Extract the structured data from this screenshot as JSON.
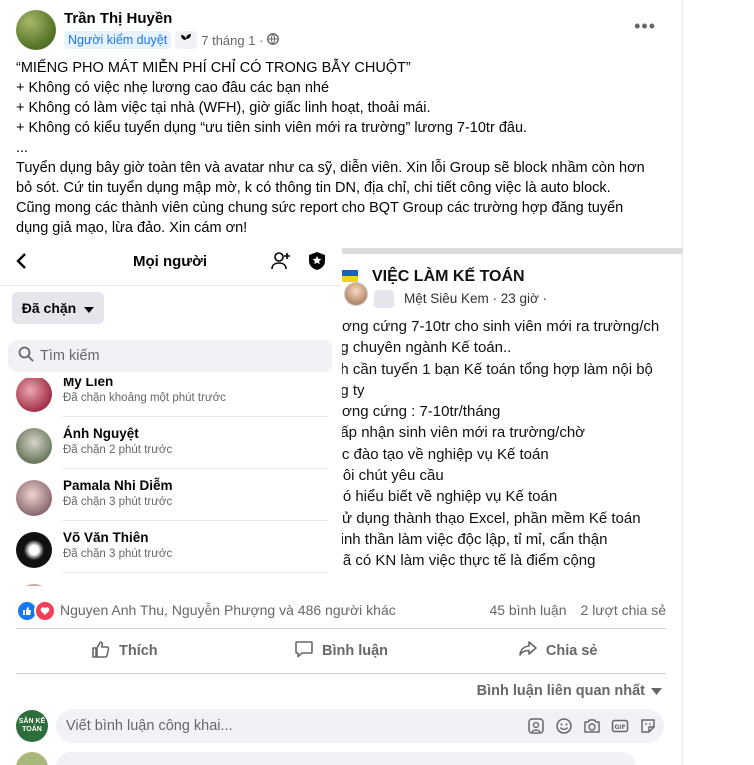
{
  "post": {
    "author": "Trần Thị Huyền",
    "badge": "Người kiểm duyệt",
    "time": "7 tháng 1 ·",
    "lines": [
      "“MIẾNG PHO MÁT MIỄN PHÍ CHỈ CÓ TRONG BẪY CHUỘT”",
      "+ Không có việc nhẹ lương cao đâu các bạn nhé",
      "+ Không có làm việc tại nhà (WFH), giờ giấc linh hoạt, thoải mái.",
      "+ Không có kiểu tuyển dụng “ưu tiên sinh viên mới ra trường” lương 7-10tr đâu.",
      "...",
      "Tuyển dụng bây giờ toàn tên và avatar như ca sỹ, diễn viên. Xin lỗi Group sẽ block nhầm còn hơn",
      "bỏ sót. Cứ tin tuyển dụng mập mờ, k có thông tin DN, địa chỉ, chi tiết công việc là auto block.",
      "Cũng mong các thành viên cùng chung sức report cho BQT Group các trường hợp đăng tuyển",
      "dụng giả mạo, lừa đảo. Xin cám ơn!"
    ]
  },
  "left_screenshot": {
    "title": "Mọi người",
    "chip": "Đã chặn",
    "search_placeholder": "Tìm kiếm",
    "people": [
      {
        "name": "My Lien",
        "sub": "Đã chặn khoảng một phút trước"
      },
      {
        "name": "Ánh Nguyệt",
        "sub": "Đã chặn 2 phút trước"
      },
      {
        "name": "Pamala Nhi Diễm",
        "sub": "Đã chặn 3 phút trước"
      },
      {
        "name": "Võ Văn Thiên",
        "sub": "Đã chặn 3 phút trước"
      }
    ]
  },
  "right_screenshot": {
    "title": "VIỆC LÀM KẾ TOÁN",
    "author": "Mệt Siêu Kem · 23 giờ ·",
    "lines": [
      "ương cứng 7-10tr cho sinh viên mới ra trường/ch",
      "ng chuyên ngành Kế toán..",
      "nh cần tuyển 1 bạn Kế toán tổng hợp làm nội bộ",
      "ng ty",
      "ương cứng : 7-10tr/tháng",
      "hấp nhận sinh viên mới ra trường/chờ",
      "ợc đào tạo về nghiệp vụ Kế toán",
      " Đôi chút yêu cầu",
      "Có hiểu biết về nghiệp vụ Kế toán",
      "Sử dụng thành thạo Excel, phần mềm Kế toán",
      "Tinh thần làm việc độc lập, tỉ mỉ, cẩn thận",
      "Đã có KN làm việc thực tế là điểm cộng"
    ]
  },
  "stats": {
    "likers": "Nguyen Anh Thu, Nguyễn Phượng và 486 người khác",
    "comments": "45 bình luận",
    "shares": "2 lượt chia sẻ"
  },
  "actions": {
    "like": "Thích",
    "comment": "Bình luận",
    "share": "Chia sẻ"
  },
  "sort_label": "Bình luận liên quan nhất",
  "commenter_avatar_text": "SĂN KẾ TOÁN",
  "comment_placeholder": "Viết bình luận công khai...",
  "colors": {
    "facebook_blue": "#1877f2",
    "love_red": "#f33e58",
    "secondary_text": "#65676b",
    "input_bg": "#f0f2f5"
  }
}
